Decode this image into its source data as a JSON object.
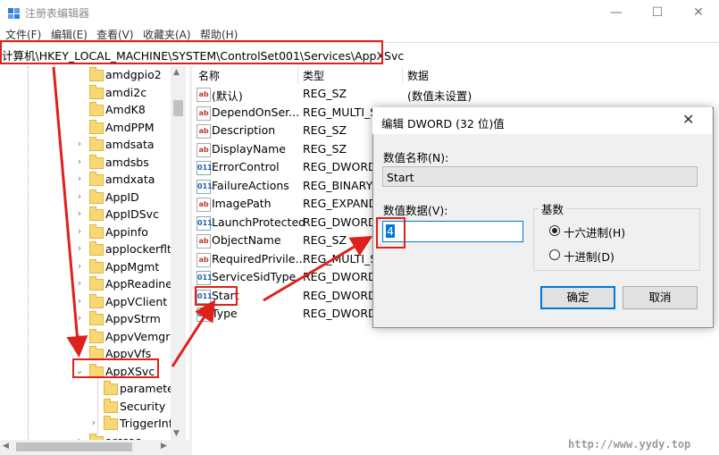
{
  "window": {
    "title": "注册表编辑器",
    "minimize": "—",
    "maximize": "☐",
    "close": "✕"
  },
  "menu": [
    "文件(F)",
    "编辑(E)",
    "查看(V)",
    "收藏夹(A)",
    "帮助(H)"
  ],
  "address": "计算机\\HKEY_LOCAL_MACHINE\\SYSTEM\\ControlSet001\\Services\\AppXSvc",
  "tree": {
    "items": [
      {
        "label": "amdgpio2",
        "chevron": ""
      },
      {
        "label": "amdi2c",
        "chevron": ""
      },
      {
        "label": "AmdK8",
        "chevron": ""
      },
      {
        "label": "AmdPPM",
        "chevron": ""
      },
      {
        "label": "amdsata",
        "chevron": "›"
      },
      {
        "label": "amdsbs",
        "chevron": "›"
      },
      {
        "label": "amdxata",
        "chevron": "›"
      },
      {
        "label": "AppID",
        "chevron": "›"
      },
      {
        "label": "AppIDSvc",
        "chevron": "›"
      },
      {
        "label": "Appinfo",
        "chevron": "›"
      },
      {
        "label": "applockerfltr",
        "chevron": "›"
      },
      {
        "label": "AppMgmt",
        "chevron": "›"
      },
      {
        "label": "AppReadiness",
        "chevron": "›"
      },
      {
        "label": "AppVClient",
        "chevron": "›"
      },
      {
        "label": "AppvStrm",
        "chevron": "›"
      },
      {
        "label": "AppvVemgr",
        "chevron": "›"
      },
      {
        "label": "AppvVfs",
        "chevron": "›"
      },
      {
        "label": "AppXSvc",
        "chevron": "⌄"
      },
      {
        "label": "parameters",
        "chevron": ""
      },
      {
        "label": "Security",
        "chevron": ""
      },
      {
        "label": "TriggerInfo",
        "chevron": "›"
      },
      {
        "label": "arcsas",
        "chevron": "›"
      }
    ]
  },
  "list": {
    "headers": {
      "name": "名称",
      "type": "类型",
      "data": "数据"
    },
    "rows": [
      {
        "name": "(默认)",
        "type": "REG_SZ",
        "data": "(数值未设置)",
        "icon": "ab"
      },
      {
        "name": "DependOnSer...",
        "type": "REG_MULTI_SZ",
        "data": "",
        "icon": "ab"
      },
      {
        "name": "Description",
        "type": "REG_SZ",
        "data": "",
        "icon": "ab"
      },
      {
        "name": "DisplayName",
        "type": "REG_SZ",
        "data": "",
        "icon": "ab"
      },
      {
        "name": "ErrorControl",
        "type": "REG_DWORD",
        "data": "",
        "icon": "bin"
      },
      {
        "name": "FailureActions",
        "type": "REG_BINARY",
        "data": "",
        "icon": "bin"
      },
      {
        "name": "ImagePath",
        "type": "REG_EXPAND_SZ",
        "data": "",
        "icon": "ab"
      },
      {
        "name": "LaunchProtected",
        "type": "REG_DWORD",
        "data": "",
        "icon": "bin"
      },
      {
        "name": "ObjectName",
        "type": "REG_SZ",
        "data": "",
        "icon": "ab"
      },
      {
        "name": "RequiredPrivile...",
        "type": "REG_MULTI_SZ",
        "data": "",
        "icon": "ab"
      },
      {
        "name": "ServiceSidType",
        "type": "REG_DWORD",
        "data": "",
        "icon": "bin"
      },
      {
        "name": "Start",
        "type": "REG_DWORD",
        "data": "",
        "icon": "bin"
      },
      {
        "name": "Type",
        "type": "REG_DWORD",
        "data": "",
        "icon": "bin"
      }
    ]
  },
  "dialog": {
    "title": "编辑 DWORD (32 位)值",
    "close": "✕",
    "value_name_label": "数值名称(N):",
    "value_name": "Start",
    "value_data_label": "数值数据(V):",
    "value_data": "4",
    "base_label": "基数",
    "hex_label": "十六进制(H)",
    "dec_label": "十进制(D)",
    "selected_base": "hex",
    "ok": "确定",
    "cancel": "取消"
  },
  "watermark": "http://www.yydy.top",
  "colors": {
    "highlight": "#e0201a",
    "accent": "#0078d7"
  }
}
